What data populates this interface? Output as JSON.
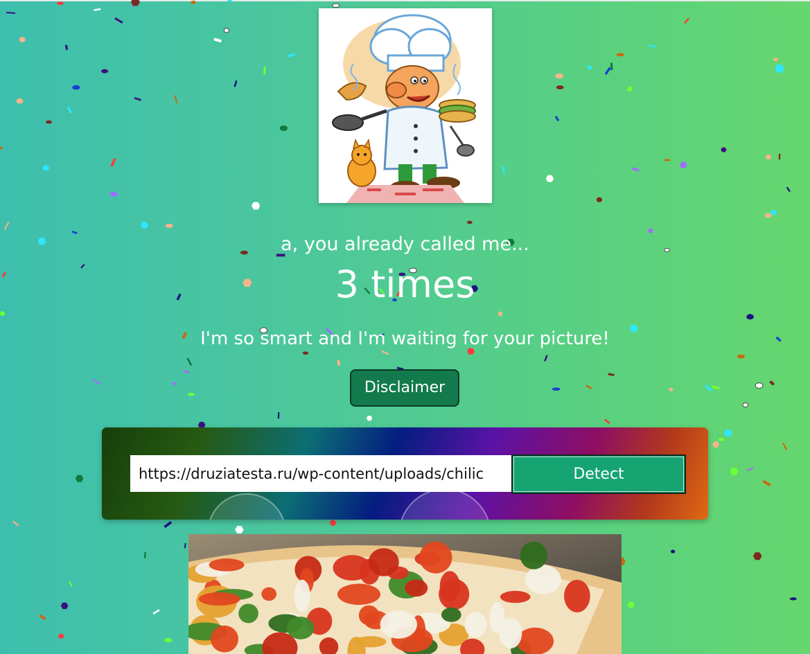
{
  "header": {
    "called_text": "a, you already called me...",
    "count_text": "3 times",
    "tagline": "I'm so smart and I'm waiting for your picture!"
  },
  "disclaimer": {
    "label": "Disclaimer"
  },
  "detector": {
    "url_value": "https://druziatesta.ru/wp-content/uploads/chilic",
    "detect_label": "Detect"
  },
  "colors": {
    "background_start": "#3ebfae",
    "background_end": "#66d66e",
    "disclaimer_button": "#137a4d",
    "detect_button": "#16a473"
  },
  "icons": {
    "chef": "chef-illustration",
    "pizza": "pizza-photo"
  }
}
